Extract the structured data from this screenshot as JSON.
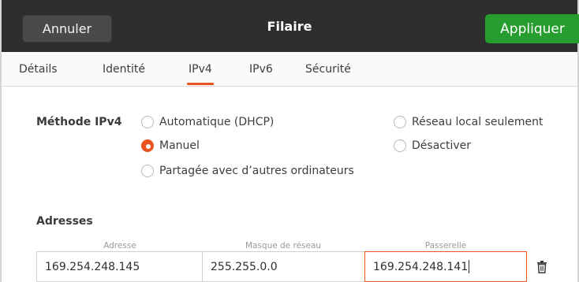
{
  "header": {
    "cancel_label": "Annuler",
    "title": "Filaire",
    "apply_label": "Appliquer"
  },
  "tabs": [
    {
      "label": "Détails",
      "active": false
    },
    {
      "label": "Identité",
      "active": false
    },
    {
      "label": "IPv4",
      "active": true
    },
    {
      "label": "IPv6",
      "active": false
    },
    {
      "label": "Sécurité",
      "active": false
    }
  ],
  "ipv4": {
    "method_label": "Méthode IPv4",
    "options": [
      {
        "label": "Automatique (DHCP)",
        "checked": false
      },
      {
        "label": "Manuel",
        "checked": true
      },
      {
        "label": "Partagée avec d’autres ordinateurs",
        "checked": false
      },
      {
        "label": "Réseau local seulement",
        "checked": false
      },
      {
        "label": "Désactiver",
        "checked": false
      }
    ]
  },
  "addresses": {
    "title": "Adresses",
    "columns": [
      "Adresse",
      "Masque de réseau",
      "Passerelle"
    ],
    "row": {
      "address": "169.254.248.145",
      "netmask": "255.255.0.0",
      "gateway": "169.254.248.141"
    },
    "delete_icon": "trash-icon"
  },
  "colors": {
    "accent": "#e95420",
    "apply_button": "#279d2f",
    "headerbar": "#2e2e2e"
  }
}
